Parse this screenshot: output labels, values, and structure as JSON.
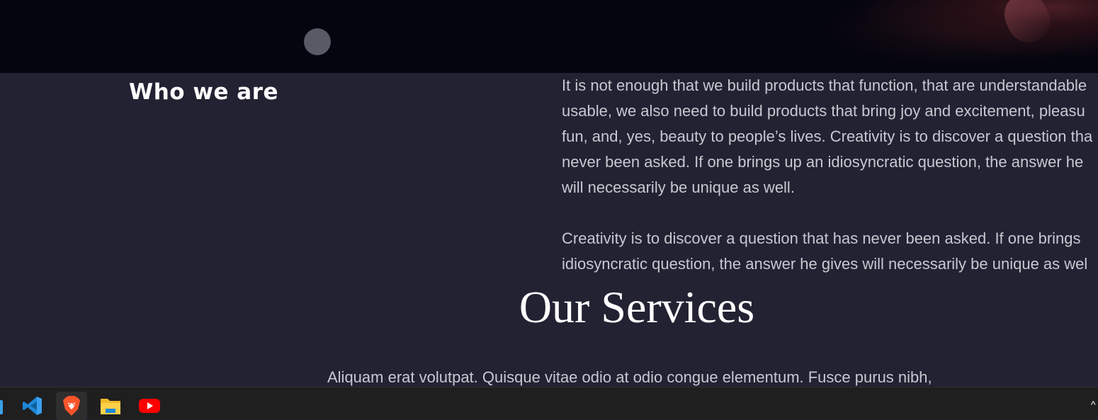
{
  "hero": {
    "dot_color": "#5a5a66"
  },
  "about": {
    "heading": "Who we are",
    "lines": [
      "It is not enough that we build products that function, that are understandable",
      "usable, we also need to build products that bring joy and excitement, pleasu",
      "fun, and, yes, beauty to people’s lives. Creativity is to discover a question tha",
      "never been asked. If one brings up an idiosyncratic question, the answer he",
      "will necessarily be unique as well."
    ],
    "lines2": [
      "Creativity is to discover a question that has never been asked. If one brings",
      "idiosyncratic question, the answer he gives will necessarily be unique as wel"
    ]
  },
  "services": {
    "title": "Our Services",
    "text": "Aliquam erat volutpat. Quisque vitae odio at odio congue elementum. Fusce purus nibh,"
  },
  "taskbar": {
    "icons": [
      "vscode-icon",
      "brave-icon",
      "file-explorer-icon",
      "youtube-icon"
    ],
    "tray_chevron": "^"
  },
  "colors": {
    "page_bg": "#222233",
    "hero_bg": "#05050f",
    "taskbar_bg": "#1f1f1f",
    "text": "#c8c8d0"
  }
}
